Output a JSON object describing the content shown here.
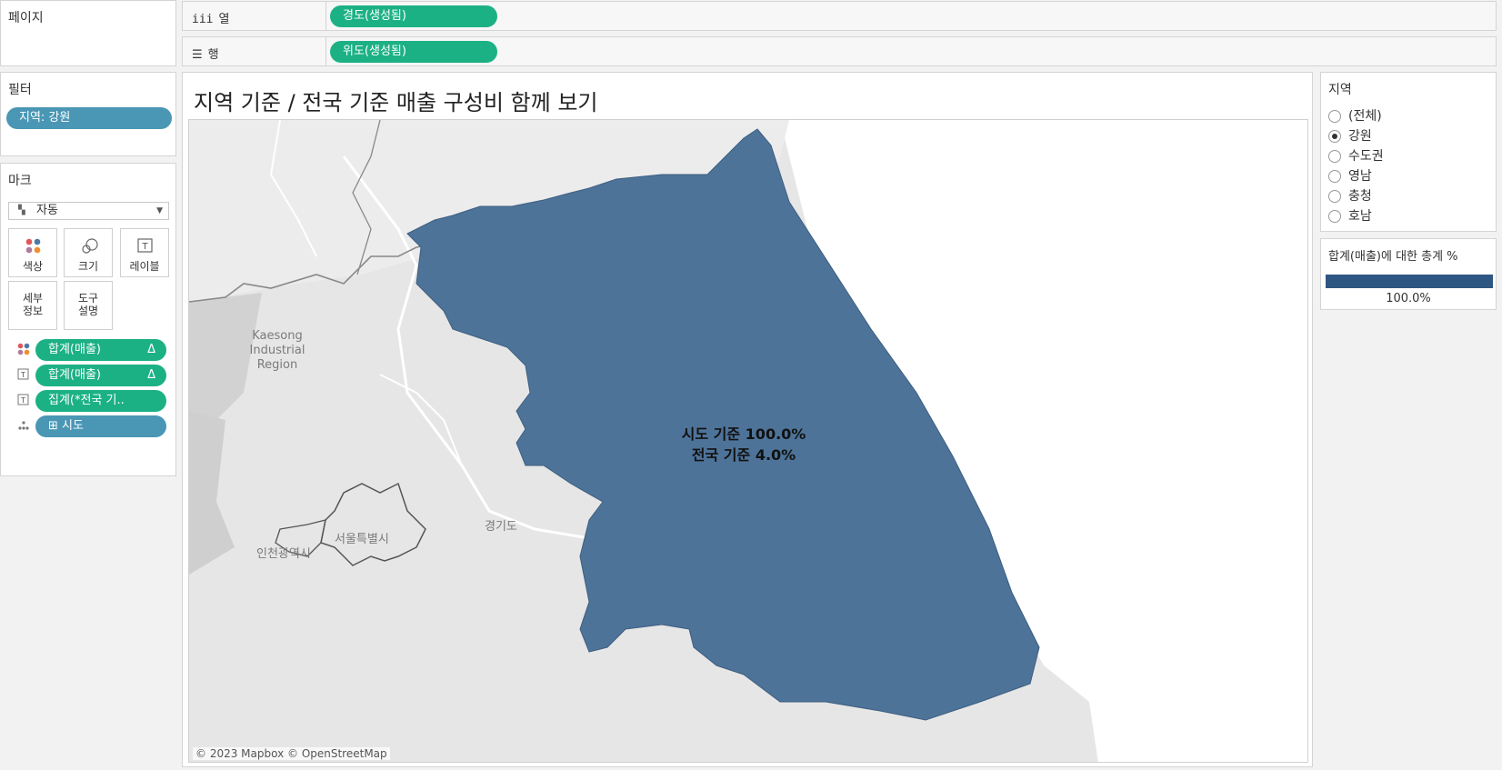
{
  "pages_panel": {
    "title": "페이지"
  },
  "columns_shelf": {
    "label": "열",
    "pill": "경도(생성됨)"
  },
  "rows_shelf": {
    "label": "행",
    "pill": "위도(생성됨)"
  },
  "filters_panel": {
    "title": "필터",
    "pill": "지역: 강원"
  },
  "marks_panel": {
    "title": "마크",
    "mark_type": "자동",
    "buttons": [
      {
        "label": "색상"
      },
      {
        "label": "크기"
      },
      {
        "label": "레이블"
      },
      {
        "label": "세부\n정보"
      },
      {
        "label": "도구\n설명"
      }
    ],
    "fields": [
      {
        "icon": "color-dots-icon",
        "label": "합계(매출)",
        "delta": "Δ"
      },
      {
        "icon": "text-label-icon",
        "label": "합계(매출)",
        "delta": "Δ"
      },
      {
        "icon": "text-label-icon",
        "label": "집계(*전국 기..",
        "delta": ""
      },
      {
        "icon": "detail-dots-icon",
        "label": "⊞ 시도",
        "delta": ""
      }
    ]
  },
  "view": {
    "title": "지역 기준 / 전국 기준 매출 구성비 함께 보기",
    "map_labels": {
      "kaesong": "Kaesong\nIndustrial\nRegion",
      "gyeonggi": "경기도",
      "seoul": "서울특별시",
      "incheon": "인천광역시"
    },
    "mark_label_line1": "시도 기준 100.0%",
    "mark_label_line2": "전국 기준 4.0%",
    "attribution": "© 2023 Mapbox © OpenStreetMap",
    "region_color": "#4e7399"
  },
  "region_filter": {
    "title": "지역",
    "options": [
      "(전체)",
      "강원",
      "수도권",
      "영남",
      "충청",
      "호남"
    ],
    "selected": "강원"
  },
  "color_legend": {
    "title": "합계(매출)에 대한 총계 %",
    "value_label": "100.0%",
    "color": "#2f5683"
  }
}
